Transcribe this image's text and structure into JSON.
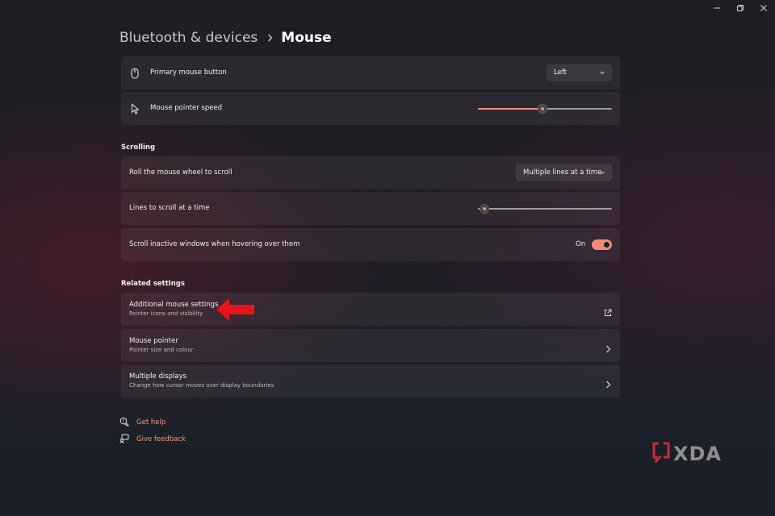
{
  "window": {
    "minimize_icon": "minimize-icon",
    "restore_icon": "restore-icon",
    "close_icon": "close-icon"
  },
  "breadcrumb": {
    "parent": "Bluetooth & devices",
    "current": "Mouse"
  },
  "settings": {
    "primary_button": {
      "label": "Primary mouse button",
      "value": "Left",
      "icon": "mouse-icon"
    },
    "pointer_speed": {
      "label": "Mouse pointer speed",
      "level": 0.48,
      "icon": "cursor-icon"
    }
  },
  "scrolling": {
    "title": "Scrolling",
    "roll_wheel": {
      "label": "Roll the mouse wheel to scroll",
      "value": "Multiple lines at a time"
    },
    "lines": {
      "label": "Lines to scroll at a time",
      "level": 0.05
    },
    "inactive": {
      "label": "Scroll inactive windows when hovering over them",
      "state": "On"
    }
  },
  "related": {
    "title": "Related settings",
    "items": [
      {
        "title": "Additional mouse settings",
        "subtitle": "Pointer icons and visibility",
        "icon": "external-link-icon"
      },
      {
        "title": "Mouse pointer",
        "subtitle": "Pointer size and colour",
        "icon": "chevron-right-icon"
      },
      {
        "title": "Multiple displays",
        "subtitle": "Change how cursor moves over display boundaries",
        "icon": "chevron-right-icon"
      }
    ]
  },
  "help": {
    "get_help": "Get help",
    "give_feedback": "Give feedback"
  },
  "logo": {
    "text": "XDA"
  },
  "colors": {
    "accent": "#f08a76",
    "link": "#f29a86",
    "annotation_arrow": "#e8141b"
  }
}
